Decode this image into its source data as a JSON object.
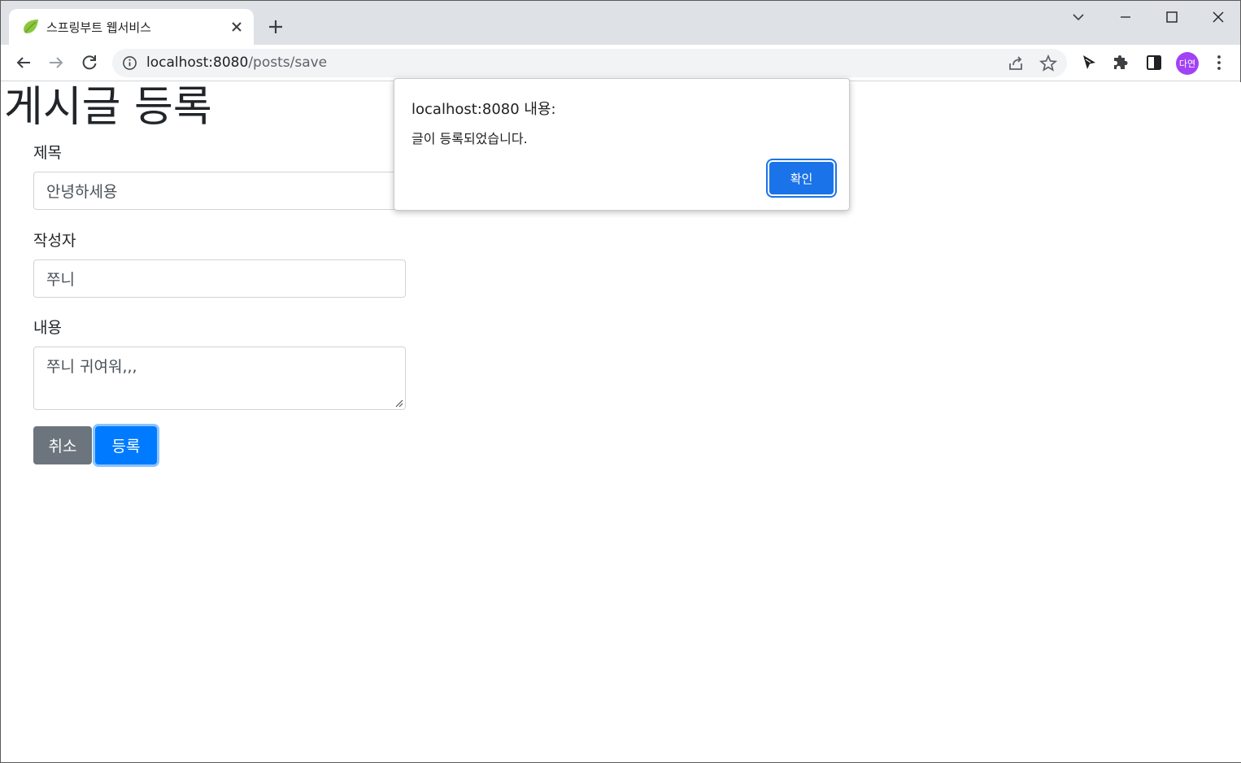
{
  "browser": {
    "tab": {
      "title": "스프링부트 웹서비스",
      "favicon": "spring-leaf-icon"
    },
    "url": {
      "host": "localhost:8080",
      "path": "/posts/save"
    },
    "profile": {
      "initials": "다연",
      "color": "#a142f4"
    }
  },
  "page": {
    "title": "게시글 등록",
    "fields": [
      {
        "label": "제목",
        "value": "안녕하세용"
      },
      {
        "label": "작성자",
        "value": "쭈니"
      },
      {
        "label": "내용",
        "value": "쭈니 귀여워,,,"
      }
    ],
    "buttons": {
      "cancel": "취소",
      "submit": "등록"
    }
  },
  "dialog": {
    "title": "localhost:8080 내용:",
    "message": "글이 등록되었습니다.",
    "ok": "확인"
  },
  "colors": {
    "primary": "#007bff",
    "secondary": "#6c757d",
    "dialog_button": "#1a73e8",
    "tabstrip": "#dee1e6"
  }
}
